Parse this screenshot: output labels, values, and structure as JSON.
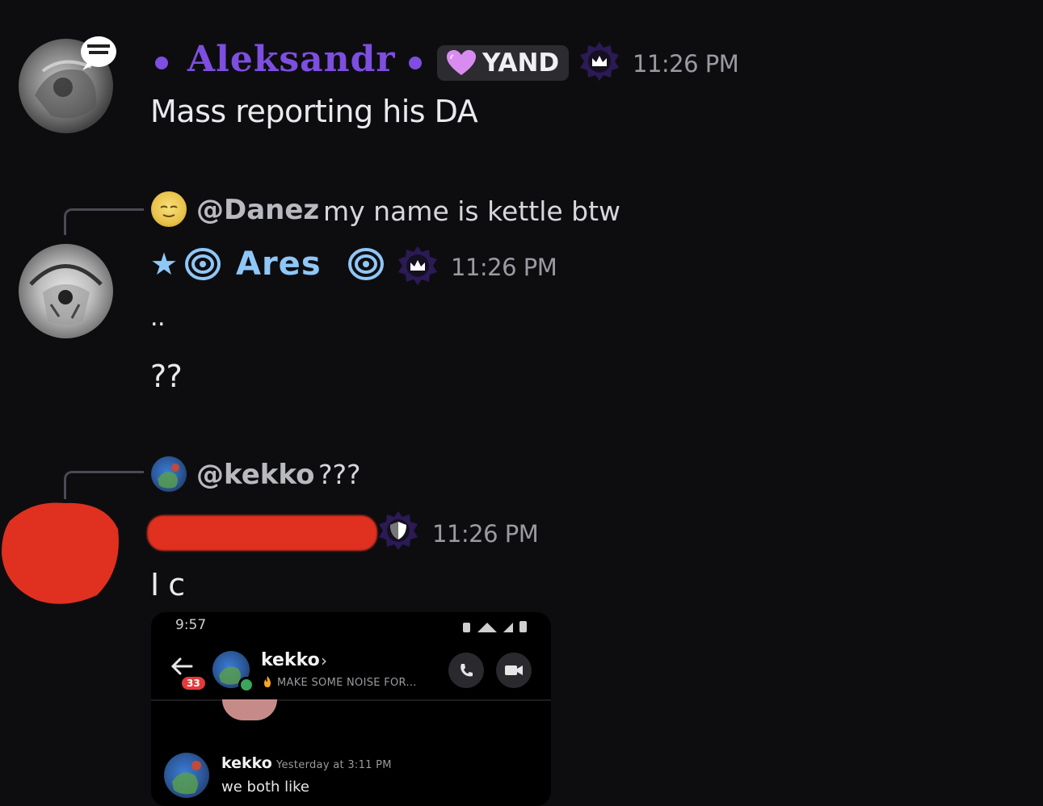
{
  "messages": [
    {
      "author": "Aleksandr",
      "role_tag": "YAND",
      "timestamp": "11:26 PM",
      "text": "Mass reporting his DA"
    },
    {
      "reply_to": {
        "mention": "@Danez",
        "text": "my name is kettle btw"
      },
      "author": "Ares",
      "author_prefix": "★",
      "timestamp": "11:26 PM",
      "lines": [
        "..",
        "??"
      ]
    },
    {
      "reply_to": {
        "mention": "@kekko",
        "text": "???"
      },
      "author": "",
      "timestamp": "11:26 PM",
      "text": "I c"
    }
  ],
  "attachment": {
    "status_time": "9:57",
    "contact_name": "kekko",
    "contact_status": "MAKE SOME NOISE FOR...",
    "unread_count": "33",
    "preview_author": "kekko",
    "preview_time": "Yesterday at 3:11 PM",
    "preview_text": "we both like"
  },
  "colors": {
    "background": "#0d0d10",
    "aleksandr": "#7d4ee0",
    "ares": "#8fc7f7",
    "redaction": "#e0301f"
  },
  "icons": [
    "gear-badge-icon",
    "heart-icon",
    "spiral-icon",
    "shield-badge-icon",
    "phone-icon",
    "video-icon",
    "back-arrow-icon"
  ]
}
